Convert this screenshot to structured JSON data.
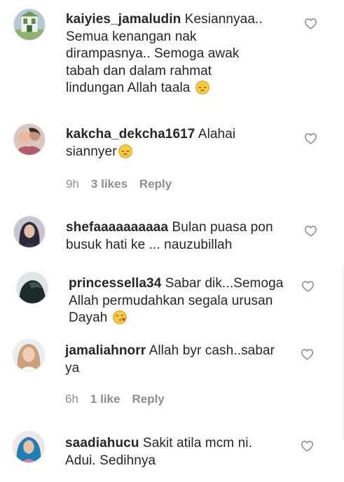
{
  "comments": [
    {
      "username": "kaiyies_jamaludin",
      "text": " Kesiannyaa..\nSemua kenangan nak\ndirampasnya.. Semoga awak\ntabah dan dalam rahmat\nlindungan Allah taala ",
      "emoji": "pensive-face-emoji"
    },
    {
      "username": "kakcha_dekcha1617",
      "text": " Alahai\nsiannyer",
      "emoji": "pensive-face-emoji",
      "time": "9h",
      "likes": "3 likes",
      "reply": "Reply"
    },
    {
      "username": "shefaaaaaaaaaa",
      "text": " Bulan puasa pon\nbusuk hati ke ... nauzubillah"
    },
    {
      "username": "princessella34",
      "text": " Sabar dik...Semoga\nAllah permudahkan segala urusan\nDayah ",
      "emoji": "face-blowing-kiss-emoji"
    },
    {
      "username": "jamaliahnorr",
      "text": " Allah byr cash..sabar\nya",
      "time": "6h",
      "likes": "1 like",
      "reply": "Reply"
    },
    {
      "username": "saadiahucu",
      "text": " Sakit atila mcm ni.\nAdui. Sedihnya"
    }
  ],
  "icons": {
    "like": "heart-outline-icon"
  },
  "colors": {
    "text": "#262626",
    "meta": "#8e8e8e",
    "heart": "#8e8e8e"
  }
}
